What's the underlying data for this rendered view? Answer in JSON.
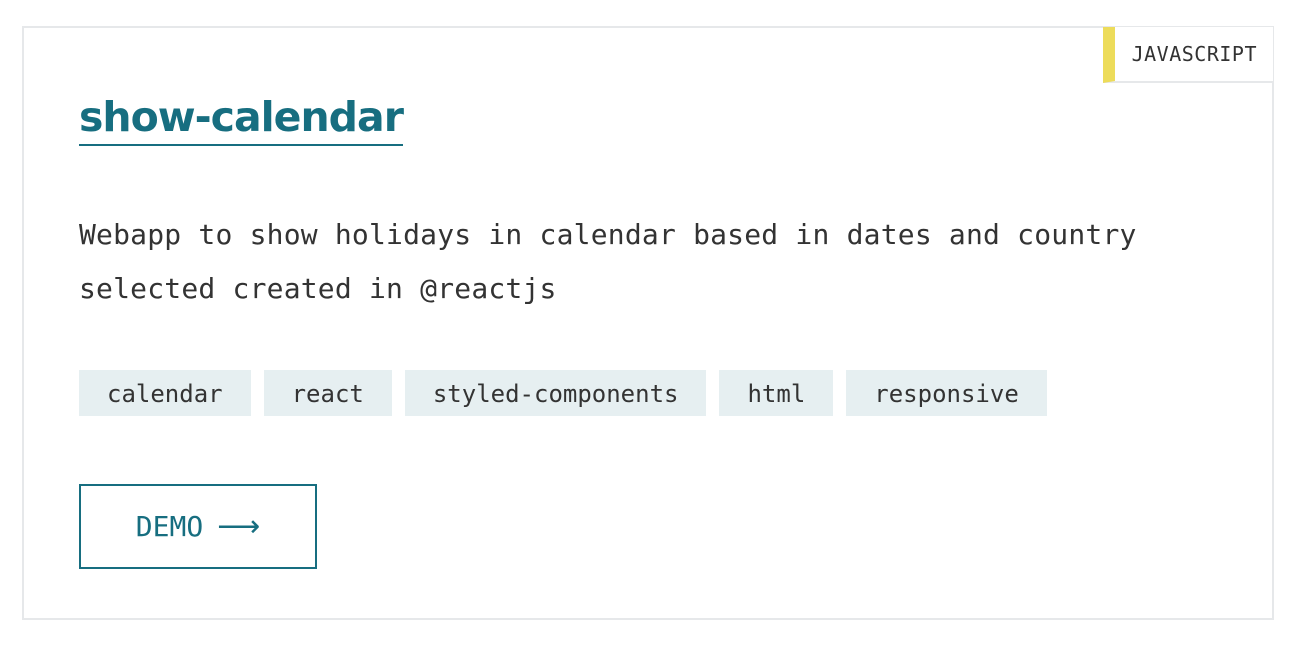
{
  "card": {
    "language": "JAVASCRIPT",
    "language_color": "#eddc5a",
    "title": "show-calendar",
    "description": "Webapp to show holidays in calendar based in dates and country selected created in @reactjs",
    "tags": [
      "calendar",
      "react",
      "styled-components",
      "html",
      "responsive"
    ],
    "demo_label": "DEMO",
    "demo_arrow": "⟶",
    "accent_color": "#176e80"
  }
}
